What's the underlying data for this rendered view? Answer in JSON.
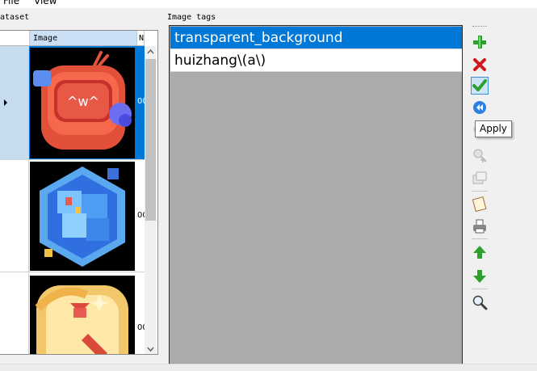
{
  "menu": {
    "file": "File",
    "view": "View"
  },
  "dataset": {
    "label": "ataset",
    "columns": {
      "image": "Image",
      "next": "N"
    },
    "rows": [
      {
        "fragment": "00",
        "image": "red tv badge"
      },
      {
        "fragment": "00",
        "image": "blue cube badge"
      },
      {
        "fragment": "00",
        "image": "gold badge"
      }
    ]
  },
  "tags": {
    "label": "Image tags",
    "items": [
      {
        "text": "transparent_background",
        "selected": true
      },
      {
        "text": "huizhang\\(a\\)",
        "selected": false
      }
    ]
  },
  "toolbar": {
    "buttons": [
      {
        "icon": "add-icon"
      },
      {
        "icon": "delete-icon"
      },
      {
        "icon": "apply-icon"
      },
      {
        "icon": "rewind-icon"
      },
      {
        "icon": "search-add-icon"
      },
      {
        "icon": "search-add-icon"
      },
      {
        "icon": "copy-icon"
      },
      {
        "icon": "paste-icon"
      },
      {
        "icon": "print-icon"
      },
      {
        "icon": "arrow-up-icon"
      },
      {
        "icon": "arrow-down-icon"
      },
      {
        "icon": "magnifier-icon"
      }
    ],
    "tooltip": "Apply"
  },
  "colors": {
    "selection": "#0078d7",
    "panel_gray": "#ababab"
  }
}
